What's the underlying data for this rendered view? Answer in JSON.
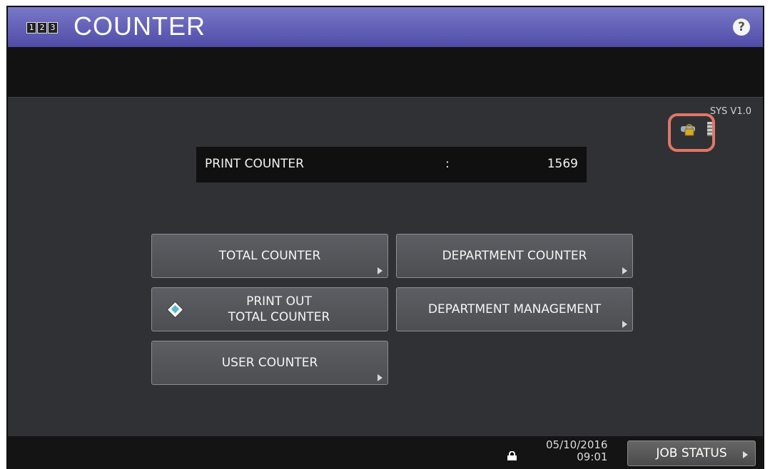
{
  "header": {
    "icon_digits": [
      "1",
      "2",
      "3"
    ],
    "title": "COUNTER",
    "help_label": "?"
  },
  "status": {
    "version": "SYS V1.0"
  },
  "print_counter": {
    "label": "PRINT COUNTER",
    "separator": ":",
    "value": "1569"
  },
  "buttons": {
    "total_counter": "TOTAL COUNTER",
    "department_counter": "DEPARTMENT COUNTER",
    "print_out_line1": "PRINT OUT",
    "print_out_line2": "TOTAL COUNTER",
    "department_management": "DEPARTMENT MANAGEMENT",
    "user_counter": "USER COUNTER"
  },
  "footer": {
    "date": "05/10/2016",
    "time": "09:01",
    "job_status": "JOB STATUS"
  },
  "colors": {
    "title_gradient_top": "#7a78c8",
    "title_gradient_bottom": "#4f4ca8",
    "highlight_ring": "#e07767",
    "start_accent": "#57b8d1"
  },
  "icons": [
    "counter-icon",
    "help-icon",
    "encryption-lock-icon",
    "card-reader-icon",
    "start-diamond-icon",
    "lock-icon",
    "arrow-icon"
  ]
}
